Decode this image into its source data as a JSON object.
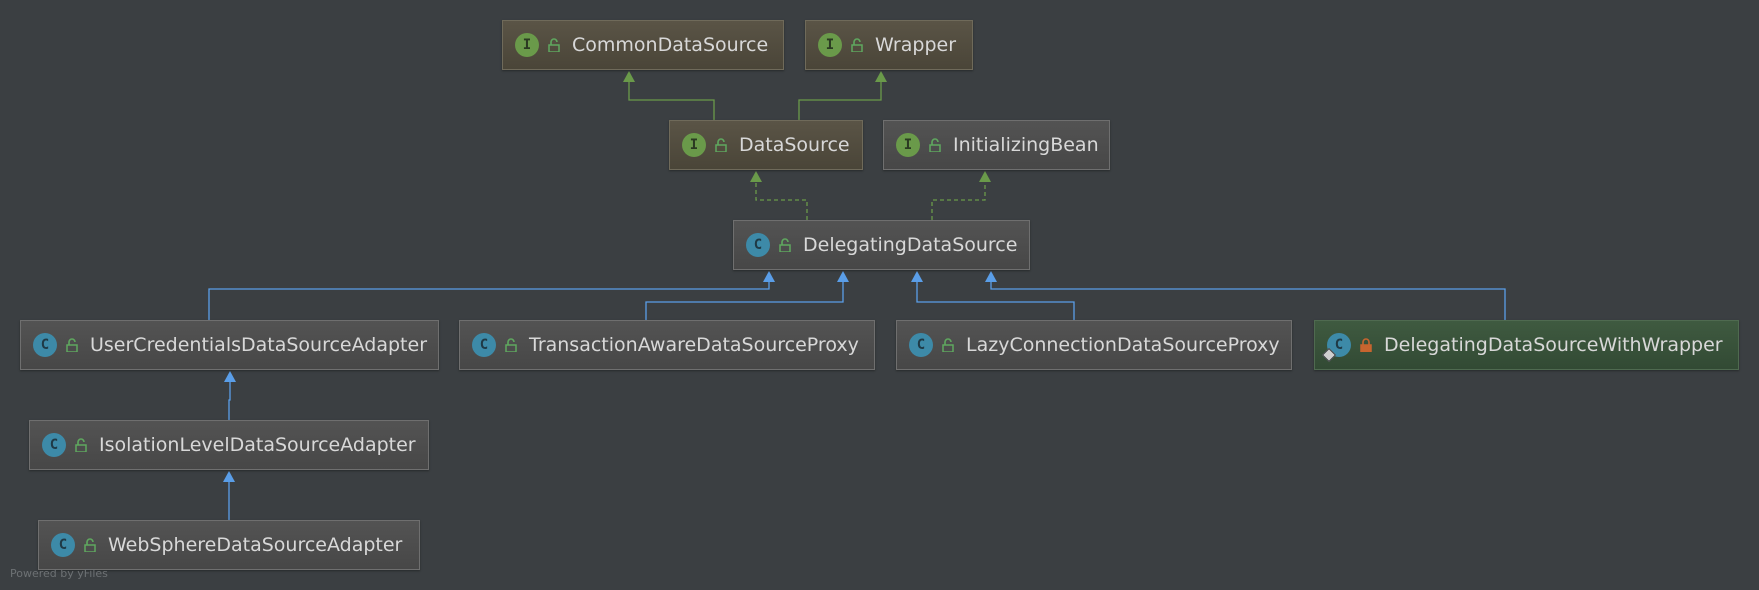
{
  "nodes": [
    {
      "id": "common",
      "name": "CommonDataSource",
      "kind": "I",
      "kind_icon": "interface-icon",
      "access": "public",
      "style": "interface"
    },
    {
      "id": "wrapper",
      "name": "Wrapper",
      "kind": "I",
      "kind_icon": "interface-icon",
      "access": "public",
      "style": "interface"
    },
    {
      "id": "datasource",
      "name": "DataSource",
      "kind": "I",
      "kind_icon": "interface-icon",
      "access": "public",
      "style": "interface"
    },
    {
      "id": "initbean",
      "name": "InitializingBean",
      "kind": "I",
      "kind_icon": "interface-icon",
      "access": "public",
      "style": "plain"
    },
    {
      "id": "delegating",
      "name": "DelegatingDataSource",
      "kind": "C",
      "kind_icon": "class-icon",
      "access": "public",
      "style": "plain"
    },
    {
      "id": "usercred",
      "name": "UserCredentialsDataSourceAdapter",
      "kind": "C",
      "kind_icon": "class-icon",
      "access": "public",
      "style": "plain"
    },
    {
      "id": "txaware",
      "name": "TransactionAwareDataSourceProxy",
      "kind": "C",
      "kind_icon": "class-icon",
      "access": "public",
      "style": "plain"
    },
    {
      "id": "lazy",
      "name": "LazyConnectionDataSourceProxy",
      "kind": "C",
      "kind_icon": "class-icon",
      "access": "public",
      "style": "plain"
    },
    {
      "id": "withwrapper",
      "name": "DelegatingDataSourceWithWrapper",
      "kind": "C",
      "kind_icon": "class-icon",
      "access": "private",
      "style": "highlight"
    },
    {
      "id": "isolation",
      "name": "IsolationLevelDataSourceAdapter",
      "kind": "C",
      "kind_icon": "class-icon",
      "access": "public",
      "style": "plain"
    },
    {
      "id": "websphere",
      "name": "WebSphereDataSourceAdapter",
      "kind": "C",
      "kind_icon": "class-icon",
      "access": "public",
      "style": "plain"
    }
  ],
  "edges": [
    {
      "from": "datasource",
      "to": "common",
      "type": "extends"
    },
    {
      "from": "datasource",
      "to": "wrapper",
      "type": "extends"
    },
    {
      "from": "delegating",
      "to": "datasource",
      "type": "implements"
    },
    {
      "from": "delegating",
      "to": "initbean",
      "type": "implements"
    },
    {
      "from": "usercred",
      "to": "delegating",
      "type": "extends"
    },
    {
      "from": "txaware",
      "to": "delegating",
      "type": "extends"
    },
    {
      "from": "lazy",
      "to": "delegating",
      "type": "extends"
    },
    {
      "from": "withwrapper",
      "to": "delegating",
      "type": "extends"
    },
    {
      "from": "isolation",
      "to": "usercred",
      "type": "extends"
    },
    {
      "from": "websphere",
      "to": "isolation",
      "type": "extends"
    }
  ],
  "colors": {
    "background": "#3b3f42",
    "interface_inheritance": "#6a9a4a",
    "class_inheritance": "#5a9ee8",
    "public_icon": "#5fa85f",
    "private_icon": "#c8652f"
  },
  "watermark": "Powered by yFiles"
}
